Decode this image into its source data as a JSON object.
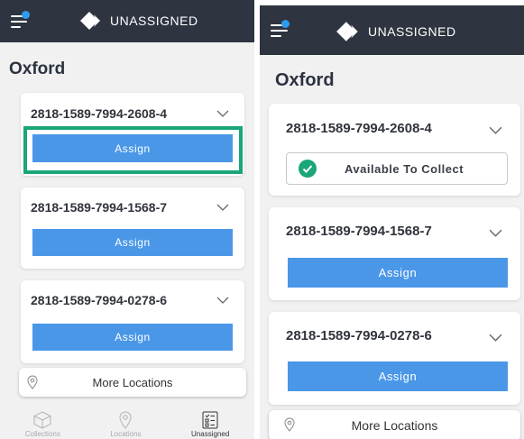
{
  "app": {
    "title": "UNASSIGNED",
    "accent": "#4a97e8",
    "header_bg": "#2e3440",
    "highlight_color": "#1aa67a",
    "success_color": "#1aa67a"
  },
  "location": {
    "name": "Oxford"
  },
  "left": {
    "cards": [
      {
        "id": "2818-1589-7994-2608-4",
        "button": "Assign"
      },
      {
        "id": "2818-1589-7994-1568-7",
        "button": "Assign"
      },
      {
        "id": "2818-1589-7994-0278-6",
        "button": "Assign"
      }
    ],
    "more_locations": "More Locations",
    "nav": [
      {
        "label": "Collections",
        "icon": "box-icon"
      },
      {
        "label": "Locations",
        "icon": "map-pin-icon"
      },
      {
        "label": "Unassigned",
        "icon": "checklist-icon"
      }
    ]
  },
  "right": {
    "cards": [
      {
        "id": "2818-1589-7994-2608-4",
        "status": "Available To Collect",
        "status_icon": "check-circle-icon"
      },
      {
        "id": "2818-1589-7994-1568-7",
        "button": "Assign"
      },
      {
        "id": "2818-1589-7994-0278-6",
        "button": "Assign"
      }
    ],
    "more_locations": "More Locations"
  }
}
